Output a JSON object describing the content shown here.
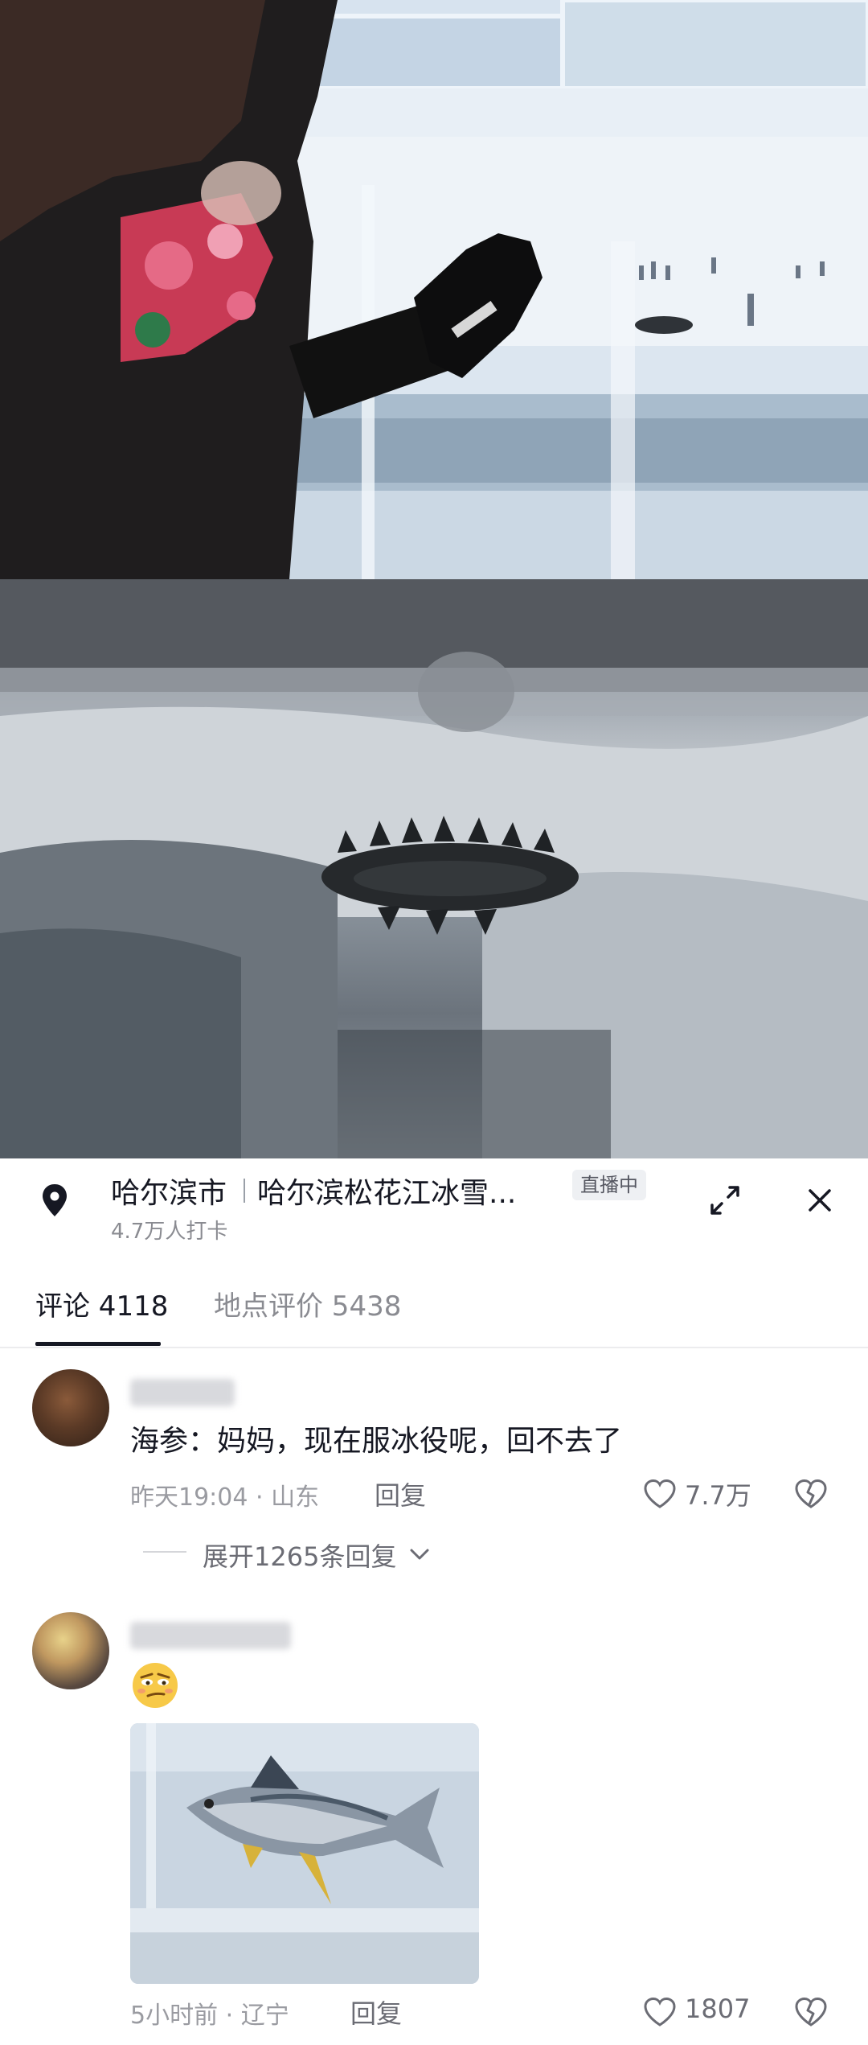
{
  "location": {
    "city": "哈尔滨市",
    "place": "哈尔滨松花江冰雪...",
    "checkins": "4.7万人打卡",
    "live_badge": "直播中"
  },
  "tabs": [
    {
      "label": "评论 4118",
      "active": true
    },
    {
      "label": "地点评价 5438",
      "active": false
    }
  ],
  "comments": [
    {
      "text": "海参：妈妈，现在服冰役呢，回不去了",
      "time": "昨天19:04",
      "region": "山东",
      "meta": "昨天19:04 · 山东",
      "reply": "回复",
      "likes": "7.7万",
      "expand": "展开1265条回复"
    },
    {
      "emoji": "smirk-emoji",
      "time": "5小时前",
      "region": "辽宁",
      "meta": "5小时前 · 辽宁",
      "reply": "回复",
      "likes": "1807"
    }
  ],
  "icons": {
    "location": "location-pin-icon",
    "expand": "expand-arrows-icon",
    "close": "close-icon",
    "like": "heart-outline-icon",
    "dislike": "broken-heart-icon",
    "chevron": "chevron-down-icon"
  },
  "colors": {
    "text_primary": "#161823",
    "text_secondary": "#8a8b91",
    "badge_bg": "#eef0f3",
    "divider": "#ececee"
  }
}
